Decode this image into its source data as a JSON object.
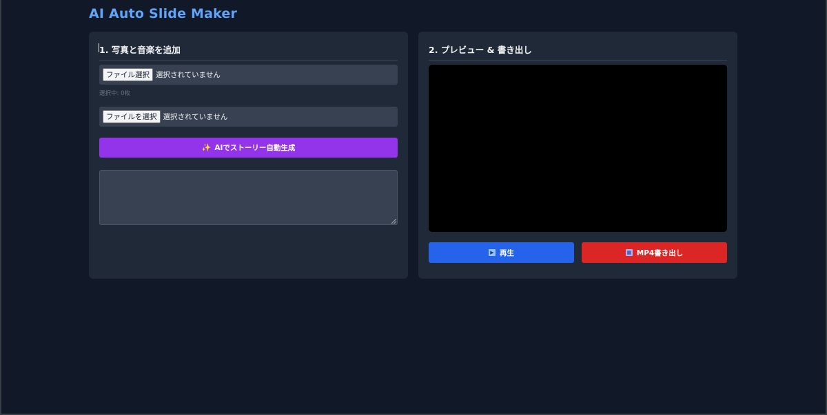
{
  "app": {
    "title": "AI Auto Slide Maker"
  },
  "left_panel": {
    "heading": "1. 写真と音楽を追加",
    "photo_input": {
      "button_label": "ファイル選択",
      "status": "選択されていません"
    },
    "selected_count": "選択中: 0枚",
    "music_input": {
      "button_label": "ファイルを選択",
      "status": "選択されていません"
    },
    "ai_button": {
      "icon": "sparkles-icon",
      "label": "AIでストーリー自動生成"
    },
    "story_textarea": {
      "value": ""
    }
  },
  "right_panel": {
    "heading": "2. プレビュー & 書き出し",
    "play_button": {
      "icon": "play-icon",
      "label": "再生"
    },
    "export_button": {
      "icon": "film-icon",
      "label": "MP4書き出し"
    }
  },
  "colors": {
    "background": "#111827",
    "panel": "#1f2937",
    "title_accent": "#60a5fa",
    "ai_button": "#9333ea",
    "play_button": "#2563eb",
    "export_button": "#dc2626"
  }
}
